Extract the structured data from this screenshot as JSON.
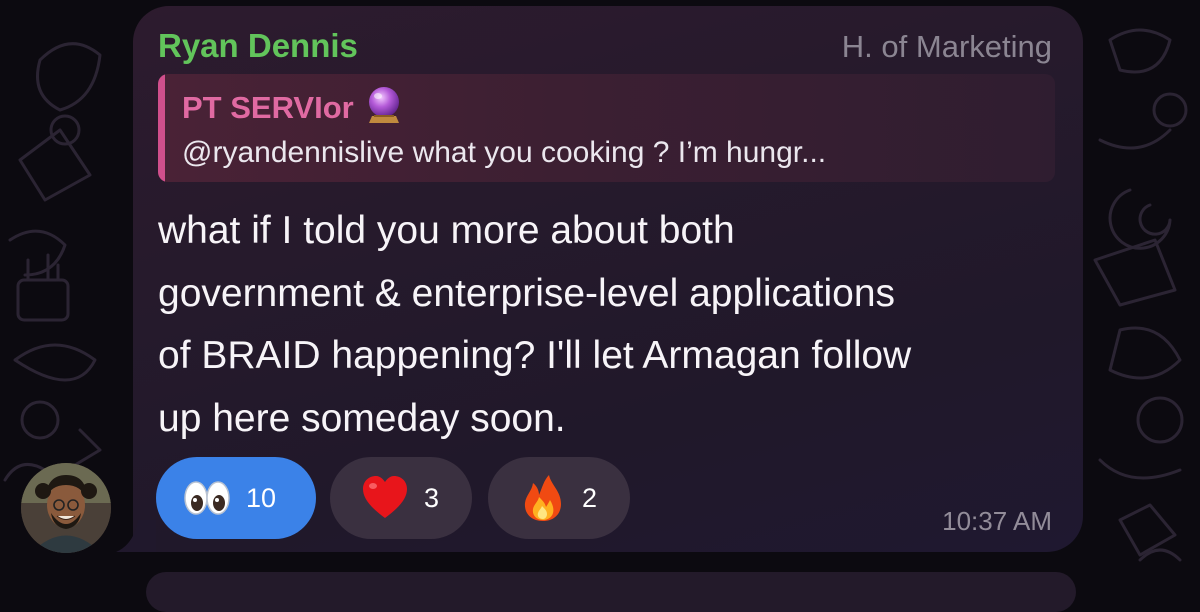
{
  "message": {
    "sender": "Ryan Dennis",
    "role": "H. of Marketing",
    "reply": {
      "author": "PT SERVIor",
      "author_emoji_icon": "crystal-ball-icon",
      "text": "@ryandennislive what you cooking ? I’m hungr..."
    },
    "body_lines": [
      "what if I told you more about both",
      "government & enterprise-level applications",
      "of BRAID happening? I'll let Armagan follow",
      "up here someday soon."
    ],
    "reactions": [
      {
        "icon": "eyes-icon",
        "count": "10",
        "active": true
      },
      {
        "icon": "heart-icon",
        "count": "3",
        "active": false
      },
      {
        "icon": "fire-icon",
        "count": "2",
        "active": false
      }
    ],
    "time": "10:37 AM"
  },
  "colors": {
    "sender": "#62c45b",
    "reply_accent": "#d04f8c",
    "reply_author": "#e06aa2",
    "active_reaction": "#3b82e8",
    "bubble": "#271a2d",
    "background": "#0c0a10"
  }
}
